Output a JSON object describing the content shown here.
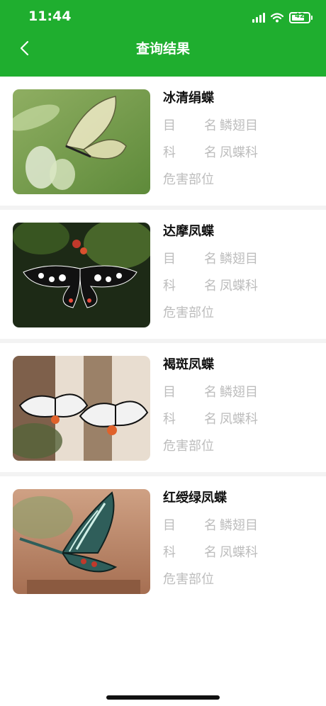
{
  "status": {
    "time": "11:44",
    "battery": "42"
  },
  "header": {
    "title": "查询结果"
  },
  "labels": {
    "order_a": "目",
    "order_b": "名",
    "family_a": "科",
    "family_b": "名",
    "damage": "危害部位"
  },
  "items": [
    {
      "name": "冰清绢蝶",
      "order": "鳞翅目",
      "family": "凤蝶科",
      "damage": ""
    },
    {
      "name": "达摩凤蝶",
      "order": "鳞翅目",
      "family": "凤蝶科",
      "damage": ""
    },
    {
      "name": "褐斑凤蝶",
      "order": "鳞翅目",
      "family": "凤蝶科",
      "damage": ""
    },
    {
      "name": "红绶绿凤蝶",
      "order": "鳞翅目",
      "family": "凤蝶科",
      "damage": ""
    }
  ]
}
